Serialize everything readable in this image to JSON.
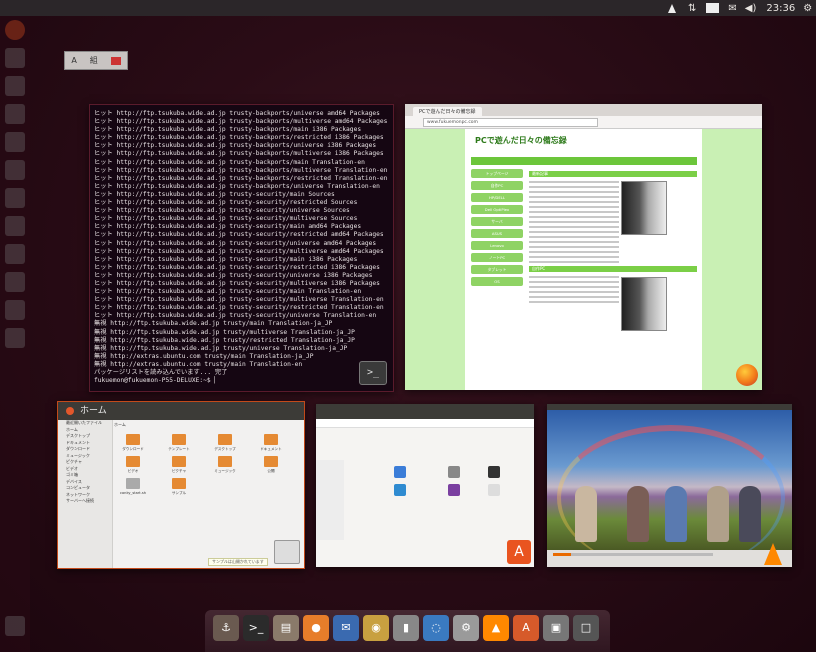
{
  "panel": {
    "clock": "23:36",
    "tray_icons": [
      "triangle-icon",
      "network-arrows-icon",
      "battery-icon",
      "mail-icon",
      "volume-icon"
    ]
  },
  "workspace_chip": {
    "items": [
      "A",
      "組"
    ]
  },
  "terminal": {
    "lines": [
      "ヒット http://ftp.tsukuba.wide.ad.jp trusty-backports/universe amd64 Packages",
      "ヒット http://ftp.tsukuba.wide.ad.jp trusty-backports/multiverse amd64 Packages",
      "ヒット http://ftp.tsukuba.wide.ad.jp trusty-backports/main i386 Packages",
      "ヒット http://ftp.tsukuba.wide.ad.jp trusty-backports/restricted i386 Packages",
      "ヒット http://ftp.tsukuba.wide.ad.jp trusty-backports/universe i386 Packages",
      "ヒット http://ftp.tsukuba.wide.ad.jp trusty-backports/multiverse i386 Packages",
      "ヒット http://ftp.tsukuba.wide.ad.jp trusty-backports/main Translation-en",
      "ヒット http://ftp.tsukuba.wide.ad.jp trusty-backports/multiverse Translation-en",
      "ヒット http://ftp.tsukuba.wide.ad.jp trusty-backports/restricted Translation-en",
      "ヒット http://ftp.tsukuba.wide.ad.jp trusty-backports/universe Translation-en",
      "ヒット http://ftp.tsukuba.wide.ad.jp trusty-security/main Sources",
      "ヒット http://ftp.tsukuba.wide.ad.jp trusty-security/restricted Sources",
      "ヒット http://ftp.tsukuba.wide.ad.jp trusty-security/universe Sources",
      "ヒット http://ftp.tsukuba.wide.ad.jp trusty-security/multiverse Sources",
      "ヒット http://ftp.tsukuba.wide.ad.jp trusty-security/main amd64 Packages",
      "ヒット http://ftp.tsukuba.wide.ad.jp trusty-security/restricted amd64 Packages",
      "ヒット http://ftp.tsukuba.wide.ad.jp trusty-security/universe amd64 Packages",
      "ヒット http://ftp.tsukuba.wide.ad.jp trusty-security/multiverse amd64 Packages",
      "ヒット http://ftp.tsukuba.wide.ad.jp trusty-security/main i386 Packages",
      "ヒット http://ftp.tsukuba.wide.ad.jp trusty-security/restricted i386 Packages",
      "ヒット http://ftp.tsukuba.wide.ad.jp trusty-security/universe i386 Packages",
      "ヒット http://ftp.tsukuba.wide.ad.jp trusty-security/multiverse i386 Packages",
      "ヒット http://ftp.tsukuba.wide.ad.jp trusty-security/main Translation-en",
      "ヒット http://ftp.tsukuba.wide.ad.jp trusty-security/multiverse Translation-en",
      "ヒット http://ftp.tsukuba.wide.ad.jp trusty-security/restricted Translation-en",
      "ヒット http://ftp.tsukuba.wide.ad.jp trusty-security/universe Translation-en",
      "無視 http://ftp.tsukuba.wide.ad.jp trusty/main Translation-ja_JP",
      "無視 http://ftp.tsukuba.wide.ad.jp trusty/multiverse Translation-ja_JP",
      "無視 http://ftp.tsukuba.wide.ad.jp trusty/restricted Translation-ja_JP",
      "無視 http://ftp.tsukuba.wide.ad.jp trusty/universe Translation-ja_JP",
      "無視 http://extras.ubuntu.com trusty/main Translation-ja_JP",
      "無視 http://extras.ubuntu.com trusty/main Translation-en",
      "パッケージリストを読み込んでいます... 完了",
      "fukuemon@fukuemon-P55-DELUXE:~$ "
    ],
    "badge": ">_"
  },
  "browser": {
    "tab_title": "PCで遊んだ日々の備忘録",
    "url": "www.fukuemonpc.com",
    "site_title": "PCで遊んだ日々の備忘録",
    "side_buttons": [
      "トップページ",
      "自作PC",
      "HP/DELL",
      "Dell OptiPlex",
      "サーバ",
      "ASUS",
      "Lenovo",
      "ノートPC",
      "タブレット",
      "OS"
    ],
    "section_headers": [
      "最新記事",
      "自作PC"
    ]
  },
  "files": {
    "title": "ホーム",
    "path": "ホーム",
    "sidebar": [
      "最近開いたファイル",
      "ホーム",
      "デスクトップ",
      "ドキュメント",
      "ダウンロード",
      "ミュージック",
      "ピクチャ",
      "ビデオ",
      "ゴミ箱",
      "デバイス",
      "コンピュータ",
      "ネットワーク",
      "サーバーへ接続"
    ],
    "items": [
      "ダウンロード",
      "テンプレート",
      "デスクトップ",
      "ドキュメント",
      "ビデオ",
      "ピクチャ",
      "ミュージック",
      "公開",
      "conky_start.sh",
      "サンプル"
    ],
    "bottom_note": "サンプルは山開かれています"
  },
  "dock": {
    "icons": [
      "anchor-icon",
      "terminal-icon",
      "files-icon",
      "firefox-icon",
      "thunderbird-icon",
      "media-icon",
      "usb-icon",
      "chat-icon",
      "settings-icon",
      "vlc-icon",
      "software-center-icon",
      "camera-icon",
      "trash-icon"
    ]
  }
}
